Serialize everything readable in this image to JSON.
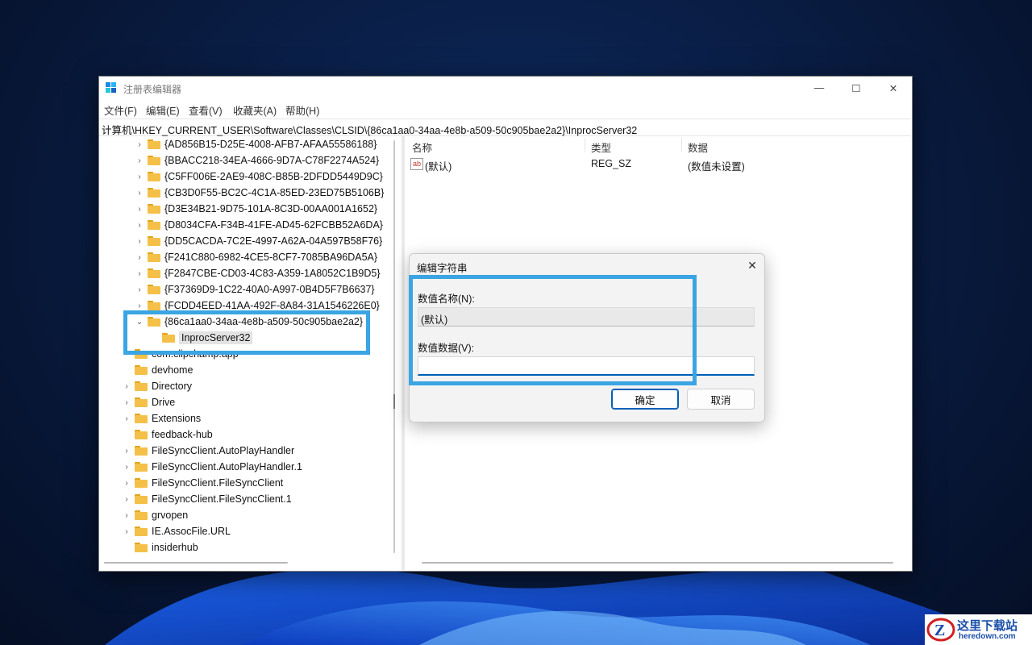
{
  "window": {
    "title": "注册表编辑器",
    "controls": {
      "minimize": "—",
      "maximize": "☐",
      "close": "✕"
    }
  },
  "menu": [
    "文件(F)",
    "编辑(E)",
    "查看(V)",
    "收藏夹(A)",
    "帮助(H)"
  ],
  "address": "计算机\\HKEY_CURRENT_USER\\Software\\Classes\\CLSID\\{86ca1aa0-34aa-4e8b-a509-50c905bae2a2}\\InprocServer32",
  "tree": {
    "clsid_children": [
      "{AD856B15-D25E-4008-AFB7-AFAA55586188}",
      "{BBACC218-34EA-4666-9D7A-C78F2274A524}",
      "{C5FF006E-2AE9-408C-B85B-2DFDD5449D9C}",
      "{CB3D0F55-BC2C-4C1A-85ED-23ED75B5106B}",
      "{D3E34B21-9D75-101A-8C3D-00AA001A1652}",
      "{D8034CFA-F34B-41FE-AD45-62FCBB52A6DA}",
      "{DD5CACDA-7C2E-4997-A62A-04A597B58F76}",
      "{F241C880-6982-4CE5-8CF7-7085BA96DA5A}",
      "{F2847CBE-CD03-4C83-A359-1A8052C1B9D5}",
      "{F37369D9-1C22-40A0-A997-0B4D5F7B6637}",
      "{FCDD4EED-41AA-492F-8A84-31A1546226E0}"
    ],
    "expanded_key": "{86ca1aa0-34aa-4e8b-a509-50c905bae2a2}",
    "selected_key": "InprocServer32",
    "classes_children": [
      {
        "label": "com.clipchamp.app",
        "expandable": false
      },
      {
        "label": "devhome",
        "expandable": false
      },
      {
        "label": "Directory",
        "expandable": true
      },
      {
        "label": "Drive",
        "expandable": true
      },
      {
        "label": "Extensions",
        "expandable": true
      },
      {
        "label": "feedback-hub",
        "expandable": false
      },
      {
        "label": "FileSyncClient.AutoPlayHandler",
        "expandable": true
      },
      {
        "label": "FileSyncClient.AutoPlayHandler.1",
        "expandable": true
      },
      {
        "label": "FileSyncClient.FileSyncClient",
        "expandable": true
      },
      {
        "label": "FileSyncClient.FileSyncClient.1",
        "expandable": true
      },
      {
        "label": "grvopen",
        "expandable": true
      },
      {
        "label": "IE.AssocFile.URL",
        "expandable": true
      },
      {
        "label": "insiderhub",
        "expandable": false
      }
    ]
  },
  "values": {
    "columns": {
      "name": "名称",
      "type": "类型",
      "data": "数据"
    },
    "rows": [
      {
        "icon": "ab",
        "name": "(默认)",
        "type": "REG_SZ",
        "data": "(数值未设置)"
      }
    ]
  },
  "dialog": {
    "title": "编辑字符串",
    "name_label": "数值名称(N):",
    "name_value": "(默认)",
    "data_label": "数值数据(V):",
    "data_value": "",
    "ok": "确定",
    "cancel": "取消"
  },
  "watermark": {
    "cn": "这里下载站",
    "en": "heredown.com"
  },
  "colors": {
    "highlight": "#3aa5e2",
    "accent": "#005fb8",
    "folder": "#f5c048"
  }
}
